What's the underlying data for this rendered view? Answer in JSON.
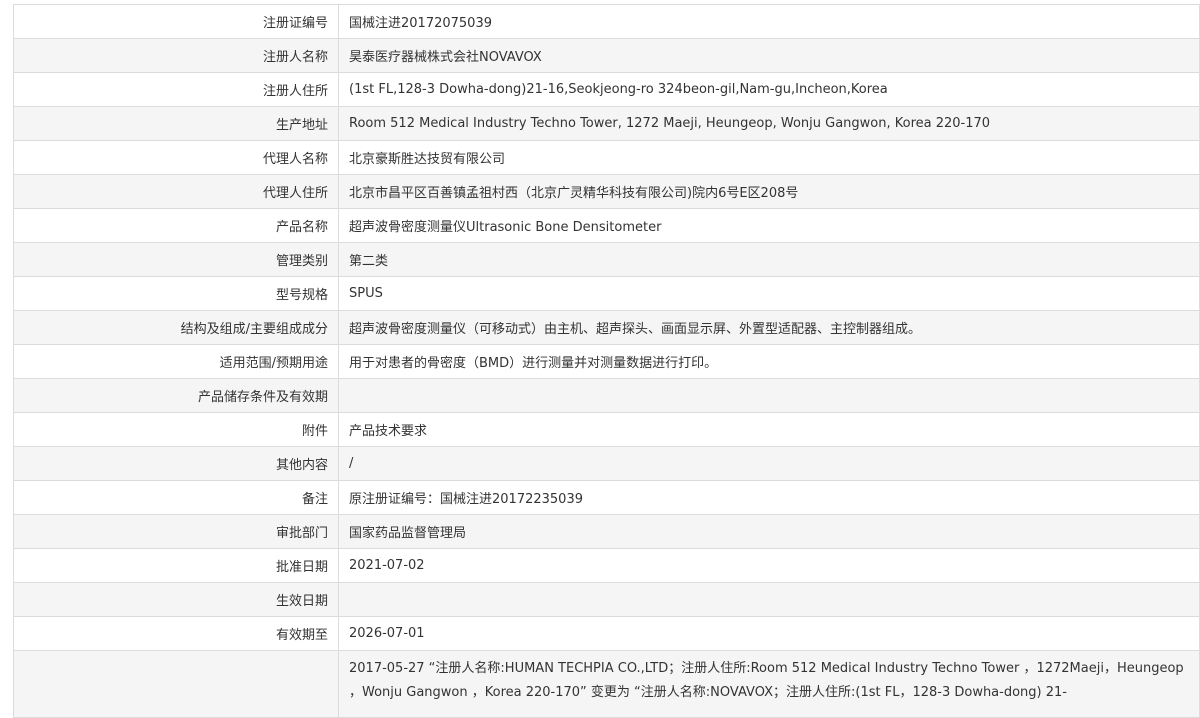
{
  "rows": [
    {
      "label": "注册证编号",
      "value": "国械注进20172075039"
    },
    {
      "label": "注册人名称",
      "value": "昊泰医疗器械株式会社NOVAVOX"
    },
    {
      "label": "注册人住所",
      "value": "(1st FL,128-3 Dowha-dong)21-16,Seokjeong-ro 324beon-gil,Nam-gu,Incheon,Korea"
    },
    {
      "label": "生产地址",
      "value": "Room 512 Medical Industry Techno Tower, 1272 Maeji, Heungeop, Wonju Gangwon, Korea 220-170"
    },
    {
      "label": "代理人名称",
      "value": "北京豪斯胜达技贸有限公司"
    },
    {
      "label": "代理人住所",
      "value": "北京市昌平区百善镇孟祖村西（北京广灵精华科技有限公司)院内6号E区208号"
    },
    {
      "label": "产品名称",
      "value": "超声波骨密度测量仪Ultrasonic Bone Densitometer"
    },
    {
      "label": "管理类别",
      "value": "第二类"
    },
    {
      "label": "型号规格",
      "value": "SPUS"
    },
    {
      "label": "结构及组成/主要组成成分",
      "value": "超声波骨密度测量仪（可移动式）由主机、超声探头、画面显示屏、外置型适配器、主控制器组成。"
    },
    {
      "label": "适用范围/预期用途",
      "value": "用于对患者的骨密度（BMD）进行测量并对测量数据进行打印。"
    },
    {
      "label": "产品储存条件及有效期",
      "value": ""
    },
    {
      "label": "附件",
      "value": "产品技术要求"
    },
    {
      "label": "其他内容",
      "value": "/"
    },
    {
      "label": "备注",
      "value": "原注册证编号：国械注进20172235039"
    },
    {
      "label": "审批部门",
      "value": "国家药品监督管理局"
    },
    {
      "label": "批准日期",
      "value": "2021-07-02"
    },
    {
      "label": "生效日期",
      "value": ""
    },
    {
      "label": "有效期至",
      "value": "2026-07-01"
    },
    {
      "label": "",
      "value": "2017-05-27 “注册人名称:HUMAN TECHPIA CO.,LTD；注册人住所:Room 512 Medical Industry Techno Tower ，1272Maeji，Heungeop ，Wonju Gangwon ，Korea 220-170” 变更为 “注册人名称:NOVAVOX；注册人住所:(1st FL，128-3 Dowha-dong) 21-"
    }
  ]
}
